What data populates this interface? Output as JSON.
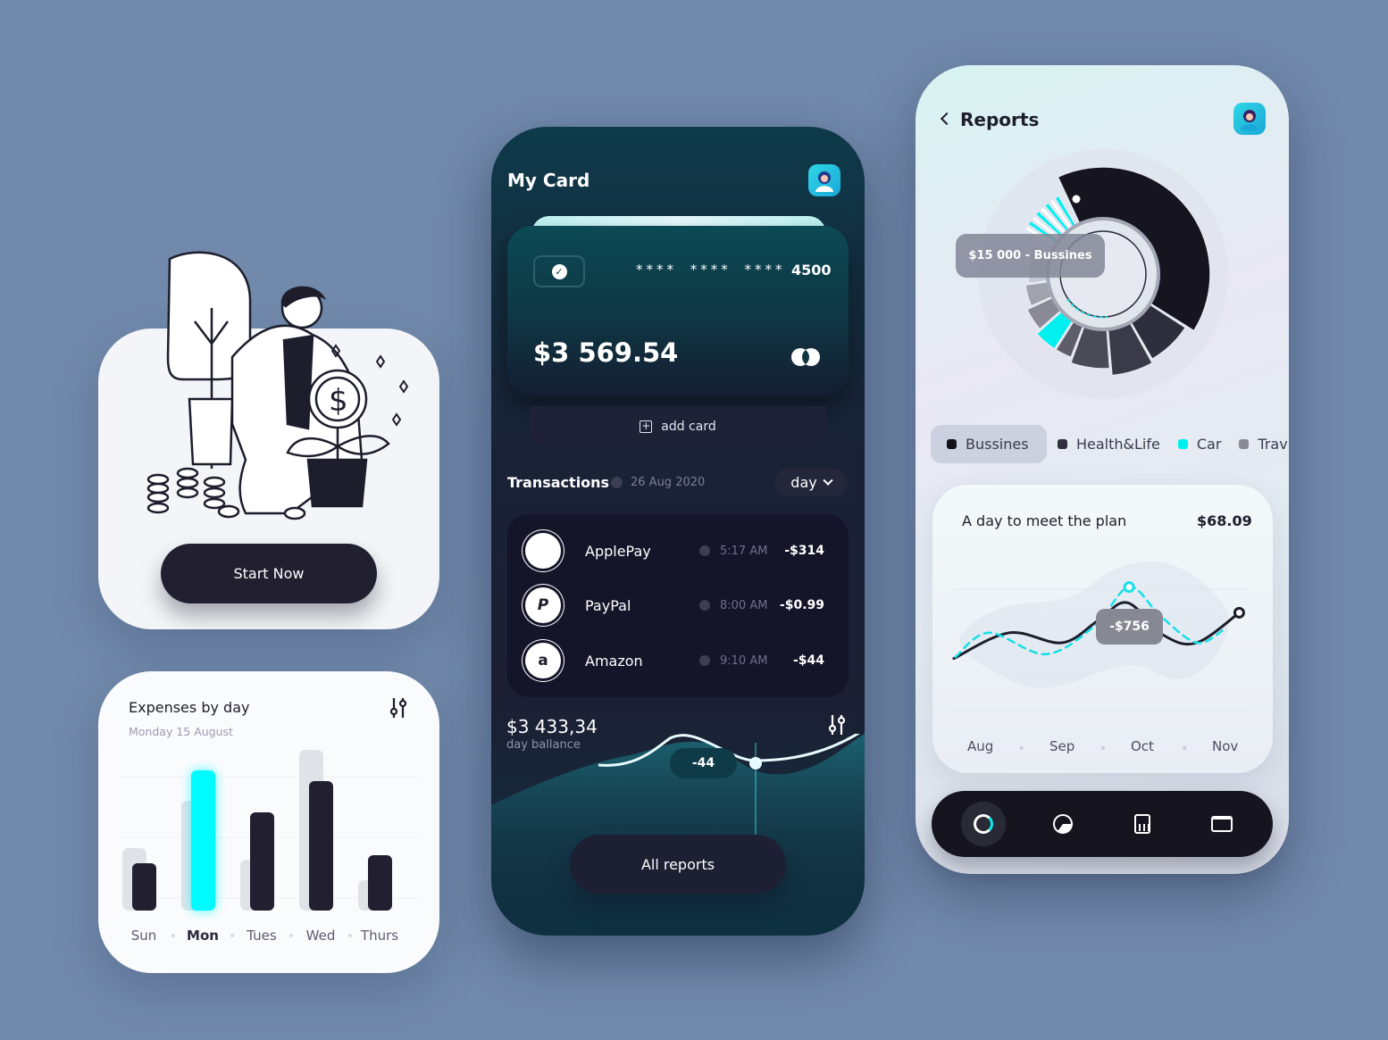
{
  "onboarding": {
    "button_label": "Start Now"
  },
  "expenses": {
    "title": "Expenses by day",
    "subtitle": "Monday 15 August",
    "filter_icon": "sliders-icon",
    "accent": "#00fbff"
  },
  "chart_data": [
    {
      "type": "bar",
      "title": "Expenses by day",
      "categories": [
        "Sun",
        "Mon",
        "Tues",
        "Wed",
        "Thurs"
      ],
      "highlighted": "Mon",
      "series": [
        {
          "values": [
            53,
            157,
            110,
            145,
            62
          ],
          "color": "#211f30"
        },
        {
          "values": [
            70,
            123,
            57,
            180,
            34
          ],
          "color": "#dfe3e8"
        }
      ],
      "ylim": [
        0,
        180
      ],
      "grid": true
    },
    {
      "type": "line",
      "title": "A day to meet the plan",
      "categories": [
        "Aug",
        "Sep",
        "Oct",
        "Nov"
      ],
      "series": [
        {
          "style": "solid",
          "color": "#1d1d2c",
          "points": [
            [
              -0.33,
              39
            ],
            [
              0.35,
              57
            ],
            [
              1.0,
              50
            ],
            [
              1.45,
              66
            ],
            [
              1.8,
              78
            ],
            [
              2.25,
              55
            ],
            [
              2.65,
              50
            ],
            [
              3.17,
              71
            ]
          ]
        },
        {
          "style": "dashed",
          "color": "#14e0e6",
          "points": [
            [
              -0.31,
              40
            ],
            [
              0.1,
              57
            ],
            [
              0.8,
              42
            ],
            [
              1.4,
              62
            ],
            [
              1.82,
              89
            ],
            [
              2.2,
              69
            ],
            [
              2.65,
              50
            ],
            [
              3.0,
              60
            ]
          ]
        }
      ],
      "annotation": "-$756",
      "grid": true
    }
  ],
  "card_screen": {
    "title": "My Card",
    "card_number": "**** **** ****",
    "card_last4": "4500",
    "card_balance": "$3 569.54",
    "add_card_label": "add card",
    "transactions_title": "Transactions",
    "transactions_date": "26 Aug 2020",
    "period_select": "day",
    "transactions": [
      {
        "logo": "apple-icon",
        "glyph": "",
        "name": "ApplePay",
        "time": "5:17 AM",
        "amount": "-$314"
      },
      {
        "logo": "paypal-icon",
        "glyph": "P",
        "name": "PayPal",
        "time": "8:00 AM",
        "amount": "-$0.99"
      },
      {
        "logo": "amazon-icon",
        "glyph": "a",
        "name": "Amazon",
        "time": "9:10 AM",
        "amount": "-$44"
      }
    ],
    "day_balance": "$3 433,34",
    "day_balance_label": "day ballance",
    "wave_marker": "-44",
    "all_reports_label": "All reports"
  },
  "reports_screen": {
    "title": "Reports",
    "donut_tooltip": "$15 000 - Bussines",
    "legend": [
      {
        "label": "Bussines",
        "color": "#12121e",
        "active": true
      },
      {
        "label": "Health&Life",
        "color": "#2e2e3c",
        "active": false
      },
      {
        "label": "Car",
        "color": "#00f0f0",
        "active": false
      },
      {
        "label": "Trav",
        "color": "#8a8a96",
        "active": false
      }
    ],
    "plan_title": "A day to meet the plan",
    "plan_value": "$68.09",
    "plan_tooltip": "-$756",
    "months": [
      "Aug",
      "Sep",
      "Oct",
      "Nov"
    ],
    "nav": [
      "donut-chart-icon",
      "pie-chart-icon",
      "calculator-icon",
      "briefcase-icon"
    ]
  }
}
